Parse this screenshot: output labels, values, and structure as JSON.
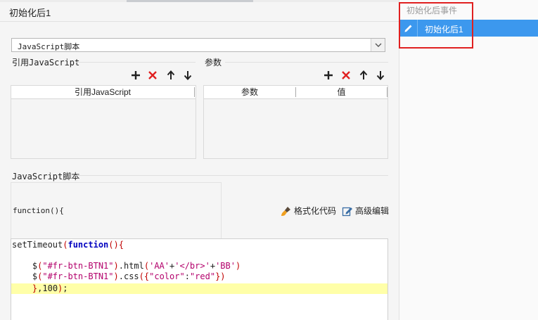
{
  "dialog": {
    "title": "初始化后1"
  },
  "script_type": {
    "selected": "JavaScript脚本"
  },
  "references": {
    "label": "引用JavaScript",
    "column": "引用JavaScript",
    "rows": []
  },
  "parameters": {
    "label": "参数",
    "columns": [
      "参数",
      "值"
    ],
    "rows": []
  },
  "toolbar_icons": [
    "add-icon",
    "delete-icon",
    "arrow-up-icon",
    "arrow-down-icon"
  ],
  "script": {
    "label": "JavaScript脚本",
    "header": "function(){",
    "format_label": "格式化代码",
    "advanced_label": "高级编辑",
    "lines": [
      "setTimeout(function(){",
      "",
      "    $(\"#fr-btn-BTN1\").html('AA'+'</br>'+'BB')",
      "    $(\"#fr-btn-BTN1\").css({\"color\":\"red\"})",
      "    },100);"
    ]
  },
  "events": {
    "header": "初始化后事件",
    "items": [
      {
        "label": "初始化后1",
        "selected": true
      }
    ]
  },
  "colors": {
    "selected_item": "#3c98ee",
    "delete_icon": "#e02020",
    "highlight_line": "#ffffa8",
    "highlight_box": "#e02020"
  }
}
